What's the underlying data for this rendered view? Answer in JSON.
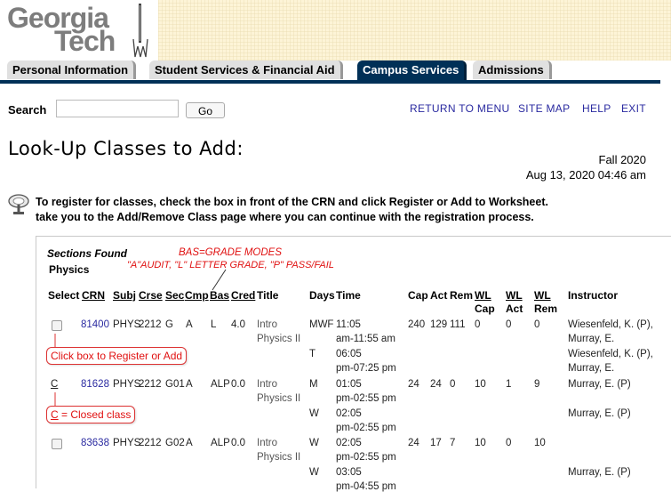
{
  "logo": {
    "line1": "Georgia",
    "line2": "Tech"
  },
  "tabs": [
    {
      "label": "Personal Information",
      "active": false
    },
    {
      "label": "Student Services & Financial Aid",
      "active": false
    },
    {
      "label": "Campus Services",
      "active": true
    },
    {
      "label": "Admissions",
      "active": false
    }
  ],
  "search": {
    "label": "Search",
    "value": "",
    "button": "Go"
  },
  "toplinks": {
    "return": "RETURN TO MENU",
    "sitemap": "SITE MAP",
    "help": "HELP",
    "exit": "EXIT"
  },
  "page": {
    "title": "Look-Up Classes to Add:",
    "term": "Fall 2020",
    "datetime": "Aug 13, 2020 04:46 am"
  },
  "instructions": {
    "line1": "To register for classes, check the box in front of the CRN and click Register or Add to Worksheet.",
    "line2": "take you to the Add/Remove Class page where you can continue with the registration process."
  },
  "table": {
    "caption": "Sections Found",
    "subject": "Physics",
    "annotations": {
      "bas": "BAS=GRADE MODES",
      "modes": "\"A\"AUDIT, \"L\" LETTER GRADE, \"P\" PASS/FAIL",
      "click_box": "Click box to Register or Add",
      "closed_c": "C",
      "closed_rest": " = Closed class"
    },
    "headers": {
      "select": "Select",
      "crn": "CRN",
      "subj": "Subj",
      "crse": "Crse",
      "sec": "Sec",
      "cmp": "Cmp",
      "bas": "Bas",
      "cred": "Cred",
      "title": "Title",
      "days": "Days",
      "time": "Time",
      "cap": "Cap",
      "act": "Act",
      "rem": "Rem",
      "wl_cap1": "WL",
      "wl_cap2": "Cap",
      "wl_act1": "WL",
      "wl_act2": "Act",
      "wl_rem1": "WL",
      "wl_rem2": "Rem",
      "instructor": "Instructor"
    },
    "rows": [
      {
        "crn": "81400",
        "subj": "PHYS",
        "crse": "2212",
        "sec": "G",
        "cmp": "A",
        "bas": "L",
        "cred": "4.0",
        "title1": "Intro",
        "title2": "Physics II",
        "m1_days": "MWF",
        "m1_time1": "11:05",
        "m1_time2": "am-11:55 am",
        "cap": "240",
        "act": "129",
        "rem": "111",
        "wlcap": "0",
        "wlact": "0",
        "wlrem": "0",
        "instr1": "Wiesenfeld, K. (P),",
        "instr2": "Murray, E.",
        "m2_days": "T",
        "m2_time1": "06:05",
        "m2_time2": "pm-07:25 pm",
        "m2_instr1": "Wiesenfeld, K. (P),",
        "m2_instr2": "Murray, E."
      },
      {
        "select": "C",
        "crn": "81628",
        "subj": "PHYS",
        "crse": "2212",
        "sec": "G01",
        "cmp": "A",
        "bas": "ALP",
        "cred": "0.0",
        "title1": "Intro",
        "title2": "Physics II",
        "m1_days": "M",
        "m1_time1": "01:05",
        "m1_time2": "pm-02:55 pm",
        "cap": "24",
        "act": "24",
        "rem": "0",
        "wlcap": "10",
        "wlact": "1",
        "wlrem": "9",
        "instr1": "Murray, E. (P)",
        "m2_days": "W",
        "m2_time1": "02:05",
        "m2_time2": "pm-02:55 pm",
        "m2_instr1": "Murray, E. (P)"
      },
      {
        "crn": "83638",
        "subj": "PHYS",
        "crse": "2212",
        "sec": "G02",
        "cmp": "A",
        "bas": "ALP",
        "cred": "0.0",
        "title1": "Intro",
        "title2": "Physics II",
        "m1_days": "W",
        "m1_time1": "02:05",
        "m1_time2": "pm-02:55 pm",
        "cap": "24",
        "act": "17",
        "rem": "7",
        "wlcap": "10",
        "wlact": "0",
        "wlrem": "10",
        "instr1": "",
        "m2_days": "W",
        "m2_time1": "03:05",
        "m2_time2": "pm-04:55 pm",
        "m2_instr1": "Murray, E. (P)"
      }
    ]
  },
  "colors": {
    "nav_blue": "#003057",
    "link": "#2a2aa0",
    "annotation_red": "#e01010",
    "banner": "#fdf4d7"
  }
}
